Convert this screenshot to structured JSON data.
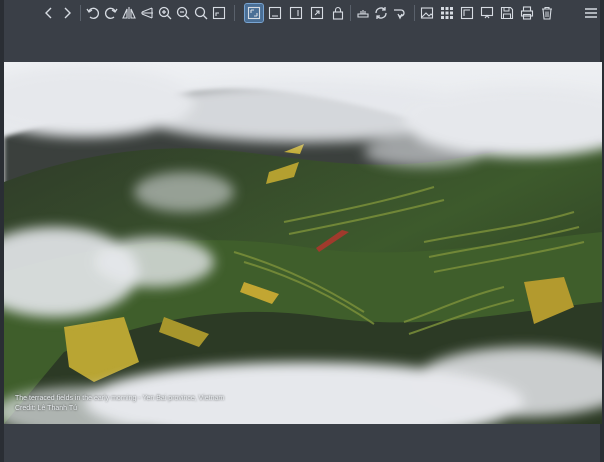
{
  "toolbar": {
    "icons": [
      "chevron-left-icon",
      "chevron-right-icon",
      "rotate-left-icon",
      "rotate-right-icon",
      "flip-horizontal-icon",
      "flip-vertical-icon",
      "zoom-in-icon",
      "zoom-out-icon",
      "zoom-icon",
      "fit-window-icon",
      "fit-width-icon",
      "fit-height-icon",
      "fit-page-icon",
      "full-screen-icon",
      "lock-icon",
      "crop-icon",
      "refresh-icon",
      "redo-icon",
      "image-icon",
      "thumbnails-icon",
      "actual-size-icon",
      "slideshow-icon",
      "save-icon",
      "print-icon",
      "delete-icon",
      "menu-icon"
    ],
    "active_icon": "fit-window-icon"
  },
  "viewer": {
    "caption_line1": "The terraced fields in the early morning - Yen Bai province, Vietnam",
    "caption_line2": "Credit: Lê Thanh Tú"
  }
}
